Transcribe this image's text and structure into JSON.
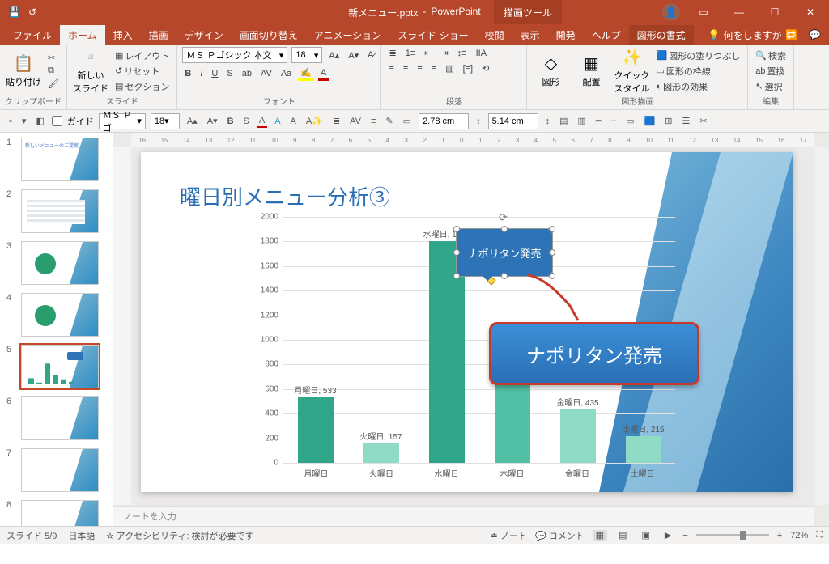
{
  "app": {
    "filename": "新メニュー.pptx",
    "appname": "PowerPoint",
    "tool_context": "描画ツール"
  },
  "tabs": {
    "file": "ファイル",
    "home": "ホーム",
    "insert": "挿入",
    "draw": "描画",
    "design": "デザイン",
    "transitions": "画面切り替え",
    "animations": "アニメーション",
    "slideshow": "スライド ショー",
    "review": "校閲",
    "view": "表示",
    "developer": "開発",
    "help": "ヘルプ",
    "shape_format": "図形の書式",
    "tell_me": "何をしますか"
  },
  "ribbon": {
    "clipboard": {
      "label": "クリップボード",
      "paste": "貼り付け"
    },
    "slides": {
      "label": "スライド",
      "newslide": "新しい\nスライド",
      "layout": "レイアウト",
      "reset": "リセット",
      "section": "セクション"
    },
    "font": {
      "label": "フォント",
      "name": "ＭＳ Ｐゴシック 本文",
      "size": "18"
    },
    "paragraph": {
      "label": "段落"
    },
    "shapes_g": {
      "label": "図形描画",
      "shapes": "図形",
      "arrange": "配置",
      "quick": "クイック\nスタイル",
      "fill": "図形の塗りつぶし",
      "outline": "図形の枠線",
      "effects": "図形の効果"
    },
    "editing": {
      "label": "編集",
      "find": "検索",
      "replace": "置換",
      "select": "選択"
    }
  },
  "quickbar": {
    "guide": "ガイド",
    "font": "ＭＳ Ｐゴ",
    "size": "18",
    "width_val": "2.78 cm",
    "height_val": "5.14 cm"
  },
  "ruler_marks": [
    "16",
    "15",
    "14",
    "13",
    "12",
    "11",
    "10",
    "9",
    "8",
    "7",
    "6",
    "5",
    "4",
    "3",
    "2",
    "1",
    "0",
    "1",
    "2",
    "3",
    "4",
    "5",
    "6",
    "7",
    "8",
    "9",
    "10",
    "11",
    "12",
    "13",
    "14",
    "15",
    "16",
    "17"
  ],
  "thumbs": {
    "selected": 5,
    "count": 8
  },
  "slide": {
    "title": "曜日別メニュー分析③",
    "callout_shape_text": "ナポリタン発売",
    "button_text": "ナポリタン発売"
  },
  "notes": {
    "placeholder": "ノートを入力"
  },
  "status": {
    "slide": "スライド 5/9",
    "lang": "日本語",
    "a11y": "アクセシビリティ: 検討が必要です",
    "notes_btn": "ノート",
    "comments_btn": "コメント",
    "zoom": "72%"
  },
  "chart_data": {
    "type": "bar",
    "title": "",
    "xlabel": "",
    "ylabel": "",
    "ylim": [
      0,
      2000
    ],
    "yticks": [
      0,
      200,
      400,
      600,
      800,
      1000,
      1200,
      1400,
      1600,
      1800,
      2000
    ],
    "categories": [
      "月曜日",
      "火曜日",
      "水曜日",
      "木曜日",
      "金曜日",
      "土曜日"
    ],
    "values": [
      533,
      157,
      1804,
      781,
      435,
      215
    ],
    "data_labels": [
      "月曜日, 533",
      "火曜日, 157",
      "水曜日, 1804",
      "木曜日, 781",
      "金曜日, 435",
      "土曜日, 215"
    ]
  }
}
